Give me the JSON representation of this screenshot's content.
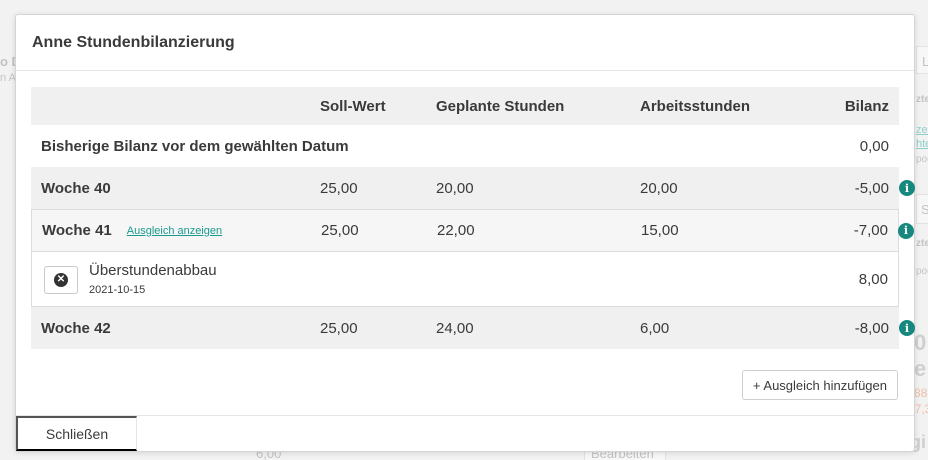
{
  "modal": {
    "title": "Anne Stundenbilanzierung",
    "columns": [
      "",
      "Soll-Wert",
      "Geplante Stunden",
      "Arbeitsstunden",
      "Bilanz"
    ],
    "previous_balance": {
      "label": "Bisherige Bilanz vor dem gewählten Datum",
      "bilanz": "0,00"
    },
    "weeks": [
      {
        "label": "Woche 40",
        "soll": "25,00",
        "geplant": "20,00",
        "arbeit": "20,00",
        "bilanz": "-5,00"
      },
      {
        "label": "Woche 41",
        "link": "Ausgleich anzeigen",
        "soll": "25,00",
        "geplant": "22,00",
        "arbeit": "15,00",
        "bilanz": "-7,00"
      },
      {
        "label": "Woche 42",
        "soll": "25,00",
        "geplant": "24,00",
        "arbeit": "6,00",
        "bilanz": "-8,00"
      }
    ],
    "adjustment": {
      "title": "Überstundenabbau",
      "date": "2021-10-15",
      "value": "8,00"
    },
    "info_glyph": "i",
    "delete_glyph": "✕",
    "add_button": "+ Ausgleich hinzufügen",
    "close_button": "Schließen",
    "colors": {
      "accent": "#17887e",
      "link": "#1a9a8f"
    }
  },
  "background": {
    "fragments": [
      "o D",
      "n A",
      "L",
      "zte",
      "zel",
      "htel",
      "poo",
      "S",
      "zte",
      "poo",
      "0",
      "e",
      "88",
      "87,3",
      "gi",
      "6,00",
      "Bearbeiten"
    ]
  }
}
